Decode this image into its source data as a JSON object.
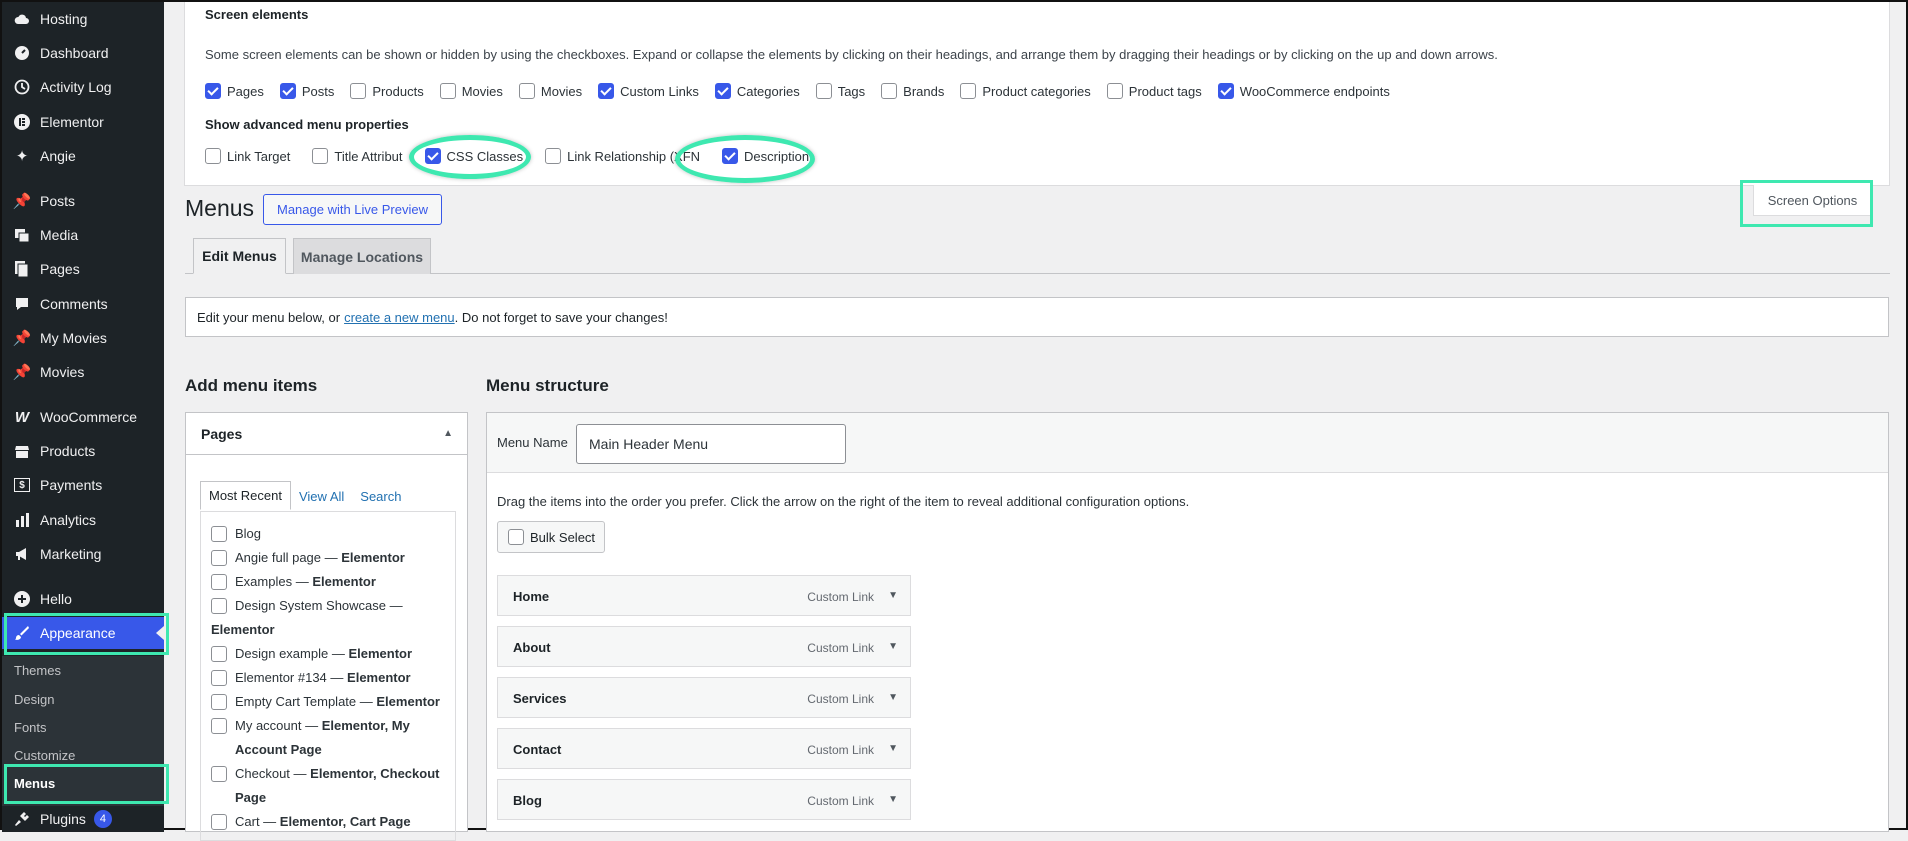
{
  "sidebar": {
    "items": [
      {
        "label": "Hosting",
        "icon": "cloud-icon"
      },
      {
        "label": "Dashboard",
        "icon": "dashboard-icon"
      },
      {
        "label": "Activity Log",
        "icon": "history-icon"
      },
      {
        "label": "Elementor",
        "icon": "elementor-icon"
      },
      {
        "label": "Angie",
        "icon": "sparkle-icon"
      },
      {
        "label": "Posts",
        "icon": "pin-icon"
      },
      {
        "label": "Media",
        "icon": "media-icon"
      },
      {
        "label": "Pages",
        "icon": "pages-icon"
      },
      {
        "label": "Comments",
        "icon": "comment-icon"
      },
      {
        "label": "My Movies",
        "icon": "pin-icon"
      },
      {
        "label": "Movies",
        "icon": "pin-icon"
      },
      {
        "label": "WooCommerce",
        "icon": "woo-icon"
      },
      {
        "label": "Products",
        "icon": "archive-icon"
      },
      {
        "label": "Payments",
        "icon": "dollar-icon"
      },
      {
        "label": "Analytics",
        "icon": "chart-bar-icon"
      },
      {
        "label": "Marketing",
        "icon": "megaphone-icon"
      },
      {
        "label": "Hello",
        "icon": "plus-circle-icon"
      },
      {
        "label": "Appearance",
        "icon": "brush-icon"
      }
    ],
    "submenu": [
      "Themes",
      "Design",
      "Fonts",
      "Customize",
      "Menus"
    ],
    "plugins": {
      "label": "Plugins",
      "badge": "4"
    }
  },
  "screen_options": {
    "title": "Screen elements",
    "description": "Some screen elements can be shown or hidden by using the checkboxes. Expand or collapse the elements by clicking on their headings, and arrange them by dragging their headings or by clicking on the up and down arrows.",
    "boxes": [
      {
        "label": "Pages",
        "checked": true
      },
      {
        "label": "Posts",
        "checked": true
      },
      {
        "label": "Products",
        "checked": false
      },
      {
        "label": "Movies",
        "checked": false
      },
      {
        "label": "Movies",
        "checked": false
      },
      {
        "label": "Custom Links",
        "checked": true
      },
      {
        "label": "Categories",
        "checked": true
      },
      {
        "label": "Tags",
        "checked": false
      },
      {
        "label": "Brands",
        "checked": false
      },
      {
        "label": "Product categories",
        "checked": false
      },
      {
        "label": "Product tags",
        "checked": false
      },
      {
        "label": "WooCommerce endpoints",
        "checked": true
      }
    ],
    "advanced_title": "Show advanced menu properties",
    "advanced": [
      {
        "label": "Link Target",
        "checked": false
      },
      {
        "label": "Title Attribut",
        "checked": false
      },
      {
        "label": "CSS Classes",
        "checked": true
      },
      {
        "label": "Link Relationship (XFN",
        "checked": false
      },
      {
        "label": "Description",
        "checked": true
      }
    ]
  },
  "header": {
    "title": "Menus",
    "live_preview": "Manage with Live Preview",
    "screen_options": "Screen Options"
  },
  "tabs": [
    "Edit Menus",
    "Manage Locations"
  ],
  "notice": {
    "before": "Edit your menu below, or",
    "link": "create a new menu",
    "after": ". Do not forget to save your changes!"
  },
  "add_items": {
    "title": "Add menu items",
    "box_title": "Pages",
    "tabs": [
      "Most Recent",
      "View All",
      "Search"
    ],
    "pages": [
      {
        "name": "Blog",
        "suffix": ""
      },
      {
        "name": "Angie full page —",
        "suffix": "Elementor"
      },
      {
        "name": "Examples —",
        "suffix": "Elementor"
      },
      {
        "name": "Design System Showcase —",
        "suffix": "Elementor"
      },
      {
        "name": "Design example —",
        "suffix": "Elementor"
      },
      {
        "name": "Elementor #134 —",
        "suffix": "Elementor"
      },
      {
        "name": "Empty Cart Template —",
        "suffix": "Elementor"
      },
      {
        "name": "My account —",
        "suffix": "Elementor, My Account Page"
      },
      {
        "name": "Checkout —",
        "suffix": "Elementor, Checkout Page"
      },
      {
        "name": "Cart —",
        "suffix": "Elementor, Cart Page"
      }
    ]
  },
  "structure": {
    "title": "Menu structure",
    "name_label": "Menu Name",
    "name_value": "Main Header Menu",
    "instructions": "Drag the items into the order you prefer. Click the arrow on the right of the item to reveal additional configuration options.",
    "bulk_select": "Bulk Select",
    "items": [
      {
        "title": "Home",
        "type": "Custom Link"
      },
      {
        "title": "About",
        "type": "Custom Link"
      },
      {
        "title": "Services",
        "type": "Custom Link"
      },
      {
        "title": "Contact",
        "type": "Custom Link"
      },
      {
        "title": "Blog",
        "type": "Custom Link"
      }
    ]
  },
  "colors": {
    "accent": "#3858e9",
    "highlight": "#3ee8b0",
    "sidebar": "#1d2327"
  }
}
